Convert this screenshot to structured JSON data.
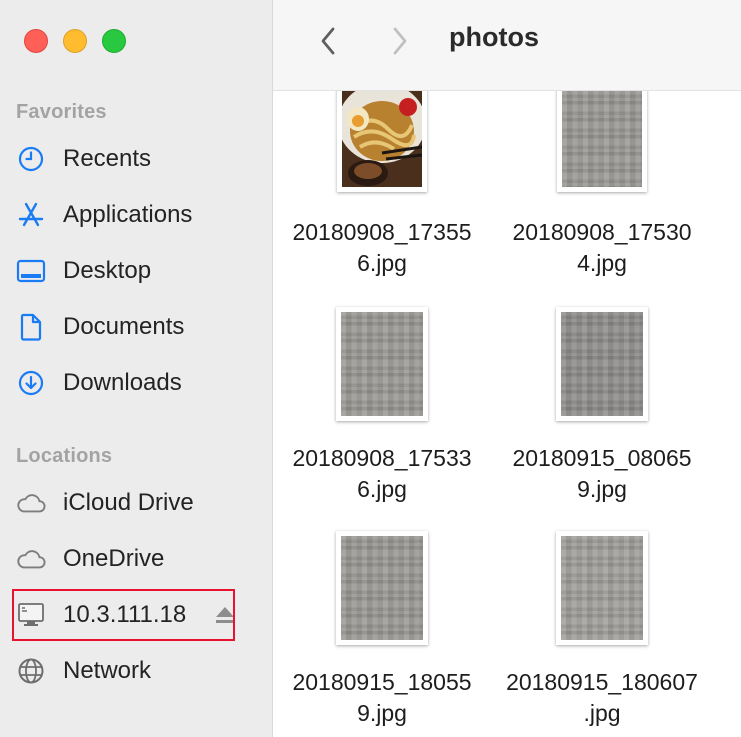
{
  "window": {
    "title": "photos"
  },
  "sidebar": {
    "favorites_title": "Favorites",
    "favorites": [
      {
        "label": "Recents",
        "icon": "clock-icon"
      },
      {
        "label": "Applications",
        "icon": "applications-icon"
      },
      {
        "label": "Desktop",
        "icon": "desktop-icon"
      },
      {
        "label": "Documents",
        "icon": "document-icon"
      },
      {
        "label": "Downloads",
        "icon": "download-icon"
      }
    ],
    "locations_title": "Locations",
    "locations": [
      {
        "label": "iCloud Drive",
        "icon": "cloud-icon"
      },
      {
        "label": "OneDrive",
        "icon": "cloud-icon"
      },
      {
        "label": "10.3.111.18",
        "icon": "server-icon",
        "highlighted": true,
        "eject": true
      },
      {
        "label": "Network",
        "icon": "globe-icon"
      }
    ]
  },
  "files": [
    {
      "line1": "20180908_17355",
      "line2": "6.jpg",
      "thumbnail": "ramen-photo"
    },
    {
      "line1": "20180908_17530",
      "line2": "4.jpg",
      "thumbnail": "pixelated"
    },
    {
      "line1": "20180908_17533",
      "line2": "6.jpg",
      "thumbnail": "pixelated"
    },
    {
      "line1": "20180915_08065",
      "line2": "9.jpg",
      "thumbnail": "pixelated"
    },
    {
      "line1": "20180915_18055",
      "line2": "9.jpg",
      "thumbnail": "pixelated"
    },
    {
      "line1": "20180915_180607",
      "line2": ".jpg",
      "thumbnail": "pixelated"
    }
  ],
  "colors": {
    "accent": "#1a7cf5",
    "highlight_border": "#e8132f",
    "sidebar_bg": "#ececec"
  }
}
